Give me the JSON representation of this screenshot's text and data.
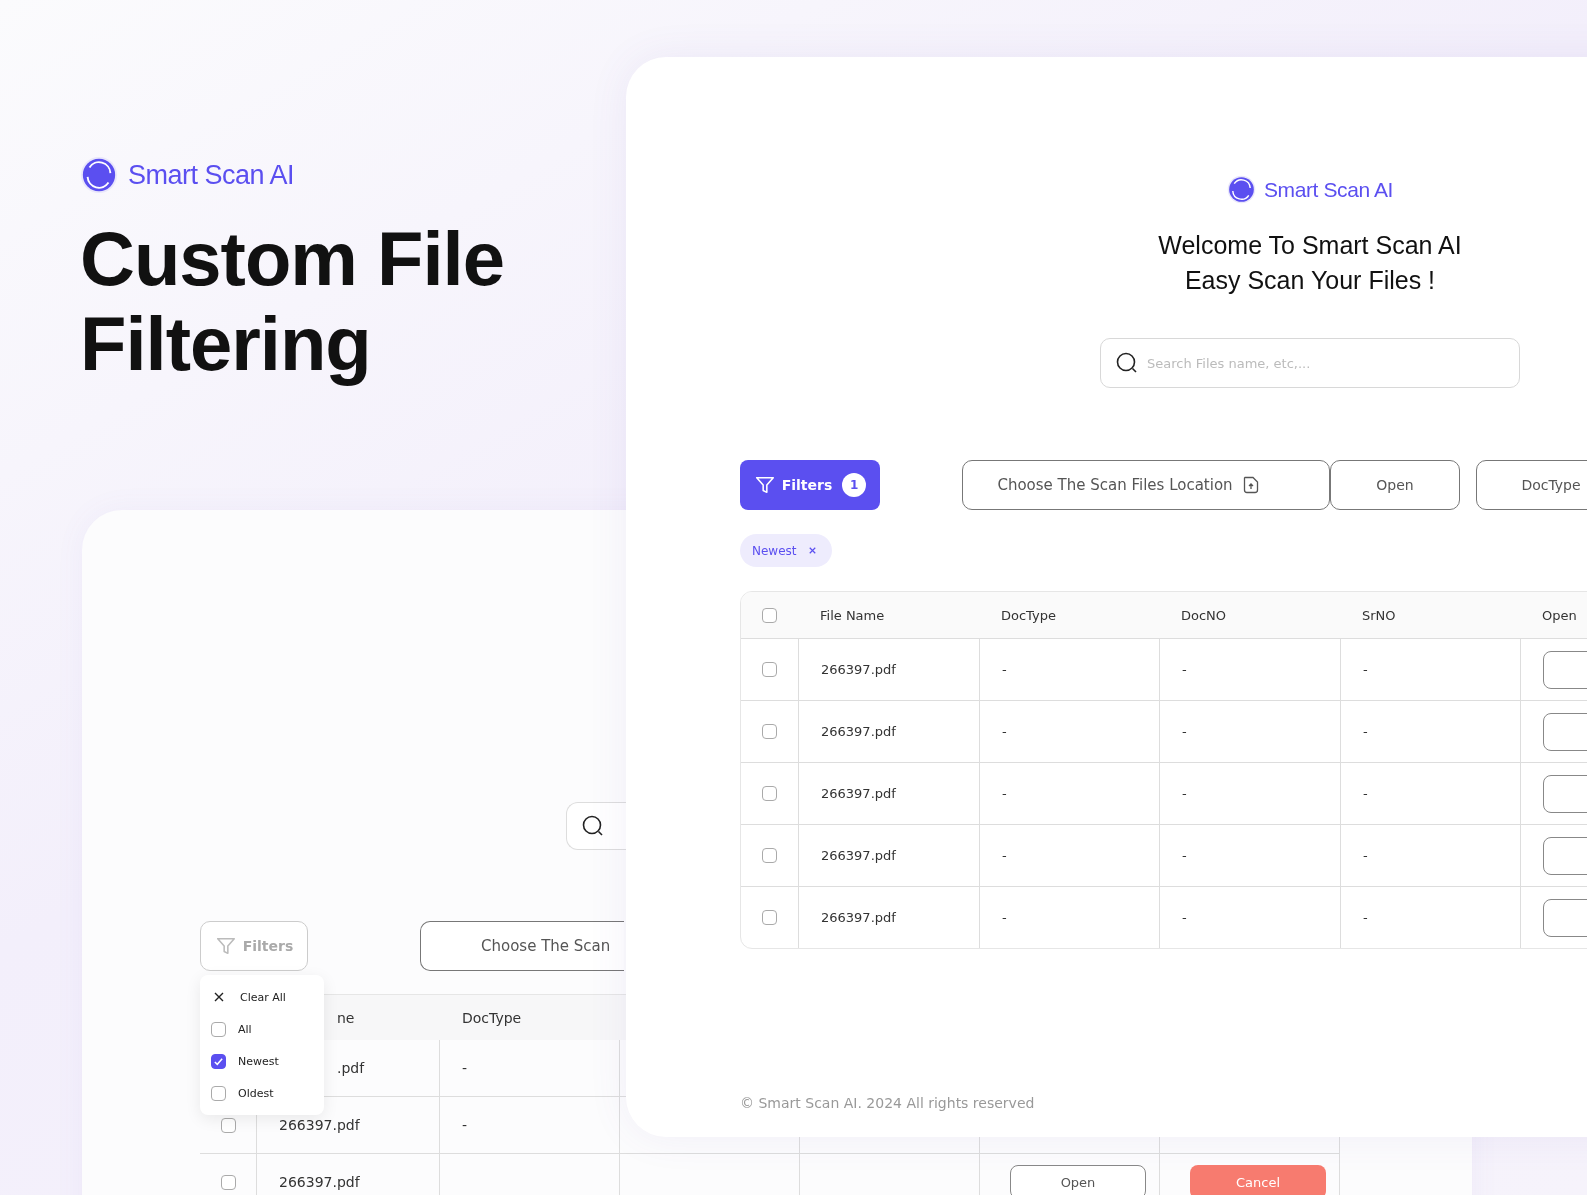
{
  "hero": {
    "brand": "Smart Scan AI",
    "title_lines": [
      "Custom File",
      "Filtering"
    ]
  },
  "back_screen": {
    "filters_button": "Filters",
    "location_button": "Choose The Scan",
    "filter_menu": {
      "clear_label": "Clear All",
      "options": [
        {
          "label": "All",
          "checked": false
        },
        {
          "label": "Newest",
          "checked": true
        },
        {
          "label": "Oldest",
          "checked": false
        }
      ]
    },
    "table": {
      "columns": [
        "ne",
        "DocType"
      ],
      "rows": [
        {
          "name": ".pdf",
          "doc_type": "-"
        },
        {
          "name": "266397.pdf",
          "doc_type": "-",
          "checked": false
        },
        {
          "name": "266397.pdf",
          "checked": false,
          "open": "Open",
          "cancel": "Cancel"
        }
      ]
    }
  },
  "front_screen": {
    "brand": "Smart Scan AI",
    "welcome_lines": [
      "Welcome To Smart Scan AI",
      "Easy Scan Your Files !"
    ],
    "search": {
      "placeholder": "Search Files name, etc,..."
    },
    "filters_button": {
      "label": "Filters",
      "count": "1"
    },
    "location_button": "Choose The Scan Files Location",
    "open_button": "Open",
    "doctype_button": "DocType",
    "active_filters": [
      {
        "label": "Newest"
      }
    ],
    "table": {
      "all_checked": false,
      "columns": [
        "File Name",
        "DocType",
        "DocNO",
        "SrNO",
        "Open"
      ],
      "rows": [
        {
          "checked": false,
          "name": "266397.pdf",
          "doc_type": "-",
          "doc_no": "-",
          "sr_no": "-"
        },
        {
          "checked": false,
          "name": "266397.pdf",
          "doc_type": "-",
          "doc_no": "-",
          "sr_no": "-"
        },
        {
          "checked": false,
          "name": "266397.pdf",
          "doc_type": "-",
          "doc_no": "-",
          "sr_no": "-"
        },
        {
          "checked": false,
          "name": "266397.pdf",
          "doc_type": "-",
          "doc_no": "-",
          "sr_no": "-"
        },
        {
          "checked": false,
          "name": "266397.pdf",
          "doc_type": "-",
          "doc_no": "-",
          "sr_no": "-"
        }
      ]
    },
    "footer": "© Smart Scan AI. 2024 All rights reserved"
  }
}
